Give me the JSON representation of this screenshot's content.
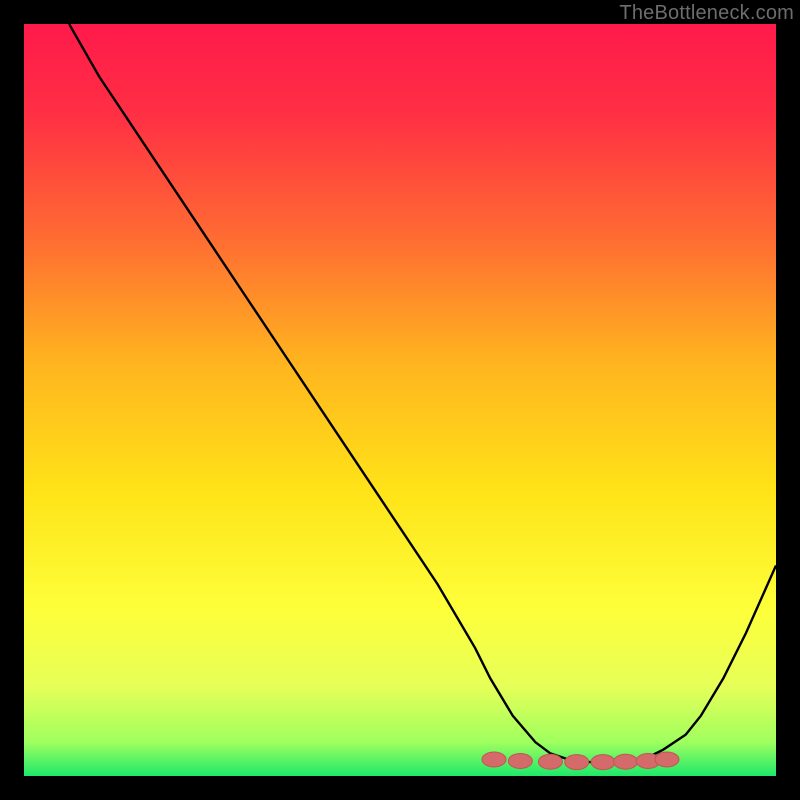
{
  "watermark": "TheBottleneck.com",
  "chart_data": {
    "type": "line",
    "title": "",
    "xlabel": "",
    "ylabel": "",
    "xlim": [
      0,
      100
    ],
    "ylim": [
      0,
      100
    ],
    "grid": false,
    "series": [
      {
        "name": "curve",
        "x": [
          6,
          10,
          15,
          20,
          25,
          30,
          35,
          40,
          45,
          50,
          55,
          60,
          62,
          65,
          68,
          70,
          73,
          76,
          80,
          83,
          85,
          88,
          90,
          93,
          96,
          100
        ],
        "y": [
          100,
          93,
          85.5,
          78,
          70.5,
          63,
          55.5,
          48,
          40.5,
          33,
          25.5,
          17,
          13,
          8,
          4.5,
          3,
          2,
          1.8,
          2,
          2.5,
          3.5,
          5.5,
          8,
          13,
          19,
          28
        ]
      }
    ],
    "markers": {
      "name": "bottom-cluster",
      "x": [
        62.5,
        66,
        70,
        73.5,
        77,
        80,
        83,
        85.5
      ],
      "y": [
        2.2,
        2.0,
        1.9,
        1.85,
        1.85,
        1.9,
        2.0,
        2.2
      ]
    },
    "gradient_stops": [
      {
        "offset": 0.0,
        "color": "#ff1a4b"
      },
      {
        "offset": 0.12,
        "color": "#ff2f44"
      },
      {
        "offset": 0.28,
        "color": "#ff6a33"
      },
      {
        "offset": 0.45,
        "color": "#ffb41f"
      },
      {
        "offset": 0.62,
        "color": "#ffe318"
      },
      {
        "offset": 0.78,
        "color": "#fdff3a"
      },
      {
        "offset": 0.88,
        "color": "#e7ff58"
      },
      {
        "offset": 0.955,
        "color": "#9fff5e"
      },
      {
        "offset": 1.0,
        "color": "#1ee86a"
      }
    ],
    "colors": {
      "curve": "#000000",
      "marker_fill": "#d46a6a",
      "marker_stroke": "#c05555",
      "background_border": "#000000"
    }
  }
}
